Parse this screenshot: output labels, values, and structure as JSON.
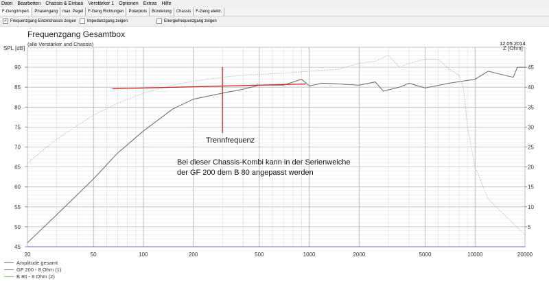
{
  "menu": [
    "Datei",
    "Bearbeiten",
    "Chassis & Einbau",
    "Verstärker 1",
    "Optionen",
    "Extras",
    "Hilfe"
  ],
  "tabs": [
    "F-Geng/Imped.",
    "Phasengang",
    "max. Pegel",
    "F-Geng Richtungen",
    "Polarplots",
    "Bündelung",
    "Chassis",
    "F-Geng elektr."
  ],
  "options": [
    {
      "label": "Frequenzgang Einzelchassis zeigen",
      "checked": true
    },
    {
      "label": "Impedanzgang zeigen",
      "checked": false
    },
    {
      "label": "Energiefrequenzgang zeigen",
      "checked": false
    }
  ],
  "date": "12.05.2014",
  "annotations": {
    "crossover": "Trennfrequenz",
    "note_line1": "Bei dieser Chassis-Kombi kann in der Serienweiche",
    "note_line2": "der GF 200  dem B 80 angepasst werden"
  },
  "chart_data": {
    "type": "line",
    "title": "Frequenzgang Gesamtbox",
    "subtitle": "(alle Verstärker und Chassis)",
    "ylabel": "SPL [dB]",
    "y2label": "Z [Ohm]",
    "xscale": "log",
    "xlim": [
      20,
      20000
    ],
    "ylim": [
      45,
      95
    ],
    "y2lim": [
      0,
      50
    ],
    "xticks": [
      20,
      50,
      100,
      200,
      500,
      1000,
      2000,
      5000,
      10000,
      20000
    ],
    "yticks": [
      45,
      50,
      55,
      60,
      65,
      70,
      75,
      80,
      85,
      90
    ],
    "y2ticks": [
      5,
      10,
      15,
      20,
      25,
      30,
      35,
      40,
      45
    ],
    "colors": {
      "amplitude": "#666666",
      "impedance": "#aaaaaa",
      "red": "#d42020",
      "grid": "#c8c8d8"
    },
    "series": [
      {
        "name": "Amplitude gesamt",
        "color": "#666666",
        "axis": "y",
        "x": [
          20,
          30,
          50,
          70,
          100,
          150,
          200,
          300,
          400,
          500,
          700,
          900,
          1000,
          1200,
          1500,
          2000,
          2500,
          2800,
          3500,
          4000,
          5000,
          7000,
          10000,
          12000,
          15000,
          17000,
          18000,
          20000
        ],
        "y": [
          46,
          53,
          62,
          68.5,
          74,
          79.5,
          82,
          83.5,
          84.5,
          85.5,
          85.5,
          87,
          85.3,
          86,
          85.8,
          85.5,
          86.3,
          84,
          85,
          86,
          84.8,
          86,
          87,
          89,
          88,
          87.5,
          90,
          90
        ]
      },
      {
        "name": "GF 200 - 8 Ohm (1)",
        "color": "#8888cc",
        "axis": "y",
        "x": [],
        "y": []
      },
      {
        "name": "B 80 - 8 Ohm (2)",
        "color": "#88cc88",
        "axis": "y",
        "x": [],
        "y": []
      },
      {
        "name": "Impedanz",
        "color": "#aaaaaa",
        "axis": "y2",
        "dotted": true,
        "x": [
          20,
          30,
          50,
          70,
          100,
          150,
          200,
          300,
          400,
          700,
          1000,
          1500,
          2000,
          2500,
          3000,
          3500,
          4000,
          5000,
          6000,
          7000,
          8000,
          8500,
          9000,
          10000,
          12000,
          15000,
          20000
        ],
        "y": [
          21,
          27,
          33,
          36,
          38.5,
          40.5,
          41.5,
          42.5,
          43,
          43.5,
          44,
          44.5,
          46,
          46.5,
          48,
          45,
          46,
          47,
          47,
          44.5,
          43,
          40,
          30,
          20,
          12,
          8,
          3
        ]
      }
    ],
    "overlay_lines": [
      {
        "x": [
          65,
          950
        ],
        "y": [
          84.6,
          85.8
        ]
      },
      {
        "x": [
          300,
          300
        ],
        "y": [
          73.5,
          90
        ]
      }
    ]
  }
}
